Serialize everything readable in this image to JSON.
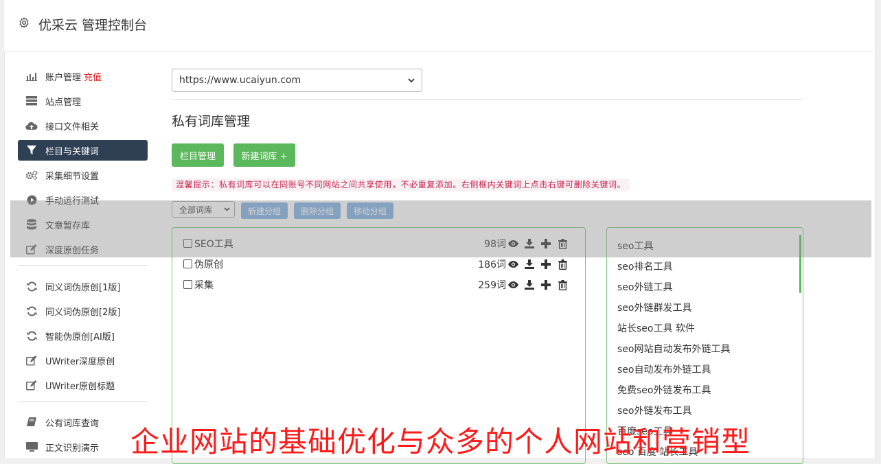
{
  "app": {
    "title": "优采云 管理控制台",
    "icon": "gear-icon"
  },
  "sidebar": {
    "group1": [
      {
        "label": "账户管理",
        "extra": "充值",
        "icon": "bar-chart-icon"
      },
      {
        "label": "站点管理",
        "icon": "server-icon"
      },
      {
        "label": "接口文件相关",
        "icon": "cloud-upload-icon"
      },
      {
        "label": "栏目与关键词",
        "icon": "filter-icon",
        "active": true
      },
      {
        "label": "采集细节设置",
        "icon": "cogs-icon"
      },
      {
        "label": "手动运行测试",
        "icon": "play-circle-icon"
      },
      {
        "label": "文章暂存库",
        "icon": "database-icon"
      },
      {
        "label": "深度原创任务",
        "icon": "edit-icon"
      }
    ],
    "group2": [
      {
        "label": "同义词伪原创[1版]",
        "icon": "refresh-icon"
      },
      {
        "label": "同义词伪原创[2版]",
        "icon": "refresh-icon"
      },
      {
        "label": "智能伪原创[AI版]",
        "icon": "refresh-icon"
      },
      {
        "label": "UWriter深度原创",
        "icon": "edit-icon"
      },
      {
        "label": "UWriter原创标题",
        "icon": "edit-icon"
      }
    ],
    "group3": [
      {
        "label": "公有词库查询",
        "icon": "book-icon"
      },
      {
        "label": "正文识别演示",
        "icon": "monitor-icon"
      }
    ]
  },
  "site_select": {
    "value": "https://www.ucaiyun.com"
  },
  "section": {
    "title": "私有词库管理"
  },
  "buttons": {
    "column_manage": "栏目管理",
    "new_library": "新建词库 +"
  },
  "tip": "温馨提示：私有词库可以在同账号不同网站之间共享使用，不必重复添加。右侧框内关键词上点击右键可删除关键词。",
  "group_toolbar": {
    "select_value": "全部词库",
    "new_group": "新建分组",
    "delete_group": "删除分组",
    "move_group": "移动分组"
  },
  "libraries": [
    {
      "name": "SEO工具",
      "count": "98词"
    },
    {
      "name": "伪原创",
      "count": "186词"
    },
    {
      "name": "采集",
      "count": "259词"
    }
  ],
  "keywords": [
    "seo工具",
    "seo排名工具",
    "seo外链工具",
    "seo外链群发工具",
    "站长seo工具 软件",
    "seo网站自动发布外链工具",
    "seo自动发布外链工具",
    "免费seo外链发布工具",
    "seo外链发布工具",
    "百度seo工具",
    "seo 百度 站长工具"
  ],
  "caption": "企业网站的基础优化与众多的个人网站和营销型",
  "colors": {
    "sidebar_active": "#2f4055",
    "green": "#5cb85c",
    "blue": "#7fb2e3",
    "tip_text": "#c7254e",
    "caption": "#ff1a1a"
  }
}
